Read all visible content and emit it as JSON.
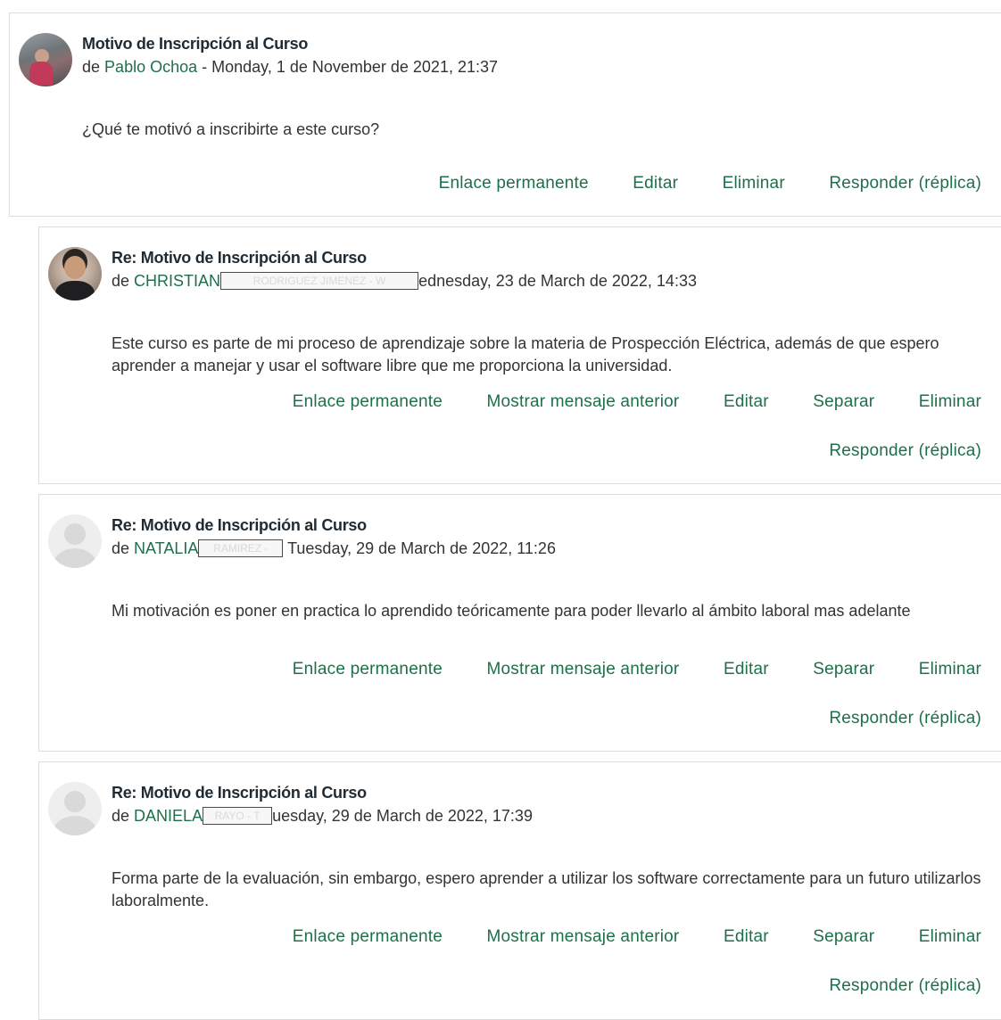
{
  "colors": {
    "link": "#1e6f4a",
    "border": "#dcdcdc",
    "text": "#333333"
  },
  "posts": [
    {
      "avatar": "user-photo-outdoor",
      "subject": "Motivo de Inscripción al Curso",
      "by_prefix": "de",
      "author": "Pablo Ochoa",
      "redacted": "",
      "date": " - Monday, 1 de November de 2021, 21:37",
      "message": "¿Qué te motivó a inscribirte a este curso?",
      "actions": {
        "permalink": "Enlace permanente",
        "edit": "Editar",
        "delete": "Eliminar",
        "reply": "Responder (réplica)"
      }
    },
    {
      "avatar": "user-photo-person",
      "subject": "Re: Motivo de Inscripción al Curso",
      "by_prefix": "de",
      "author": "CHRISTIAN",
      "redacted": "RODRIGUEZ JIMENEZ - W",
      "date": "ednesday, 23 de March de 2022, 14:33",
      "message": "Este curso es parte de mi proceso de aprendizaje sobre la materia de Prospección Eléctrica, además de que espero aprender a manejar y usar el software libre que me proporciona la universidad.",
      "actions": {
        "permalink": "Enlace permanente",
        "show_parent": "Mostrar mensaje anterior",
        "edit": "Editar",
        "split": "Separar",
        "delete": "Eliminar",
        "reply": "Responder (réplica)"
      }
    },
    {
      "avatar": "default-user-avatar",
      "subject": "Re: Motivo de Inscripción al Curso",
      "by_prefix": "de",
      "author": "NATALIA",
      "redacted": "RAMIREZ -",
      "date": " Tuesday, 29 de March de 2022, 11:26",
      "message": "Mi motivación es poner en practica lo aprendido teóricamente para poder llevarlo al ámbito laboral mas adelante",
      "actions": {
        "permalink": "Enlace permanente",
        "show_parent": "Mostrar mensaje anterior",
        "edit": "Editar",
        "split": "Separar",
        "delete": "Eliminar",
        "reply": "Responder (réplica)"
      }
    },
    {
      "avatar": "default-user-avatar",
      "subject": "Re: Motivo de Inscripción al Curso",
      "by_prefix": "de",
      "author": "DANIELA",
      "redacted": "RAYO - T",
      "date": "uesday, 29 de March de 2022, 17:39",
      "message": "Forma parte de la evaluación, sin embargo, espero aprender a utilizar los software correctamente para un futuro utilizarlos laboralmente.",
      "actions": {
        "permalink": "Enlace permanente",
        "show_parent": "Mostrar mensaje anterior",
        "edit": "Editar",
        "split": "Separar",
        "delete": "Eliminar",
        "reply": "Responder (réplica)"
      }
    }
  ]
}
